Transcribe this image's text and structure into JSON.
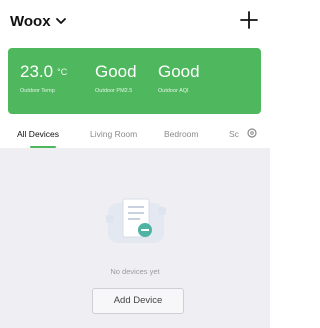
{
  "header": {
    "home_name": "Woox",
    "chevron_icon": "chevron-down-icon",
    "add_icon": "plus-icon"
  },
  "weather": {
    "temp": {
      "value": "23.0",
      "unit": "°C",
      "label": "Outdoor Temp"
    },
    "pm25": {
      "value": "Good",
      "label": "Outdoor PM2.5"
    },
    "aqi": {
      "value": "Good",
      "label": "Outdoor AQI"
    },
    "color": "#4fb85e"
  },
  "tabs": [
    {
      "label": "All Devices",
      "active": true
    },
    {
      "label": "Living Room",
      "active": false
    },
    {
      "label": "Bedroom",
      "active": false
    },
    {
      "label": "Sc",
      "active": false
    }
  ],
  "tab_settings_icon": "gear-icon",
  "empty_state": {
    "text": "No devices yet",
    "button_label": "Add Device"
  }
}
